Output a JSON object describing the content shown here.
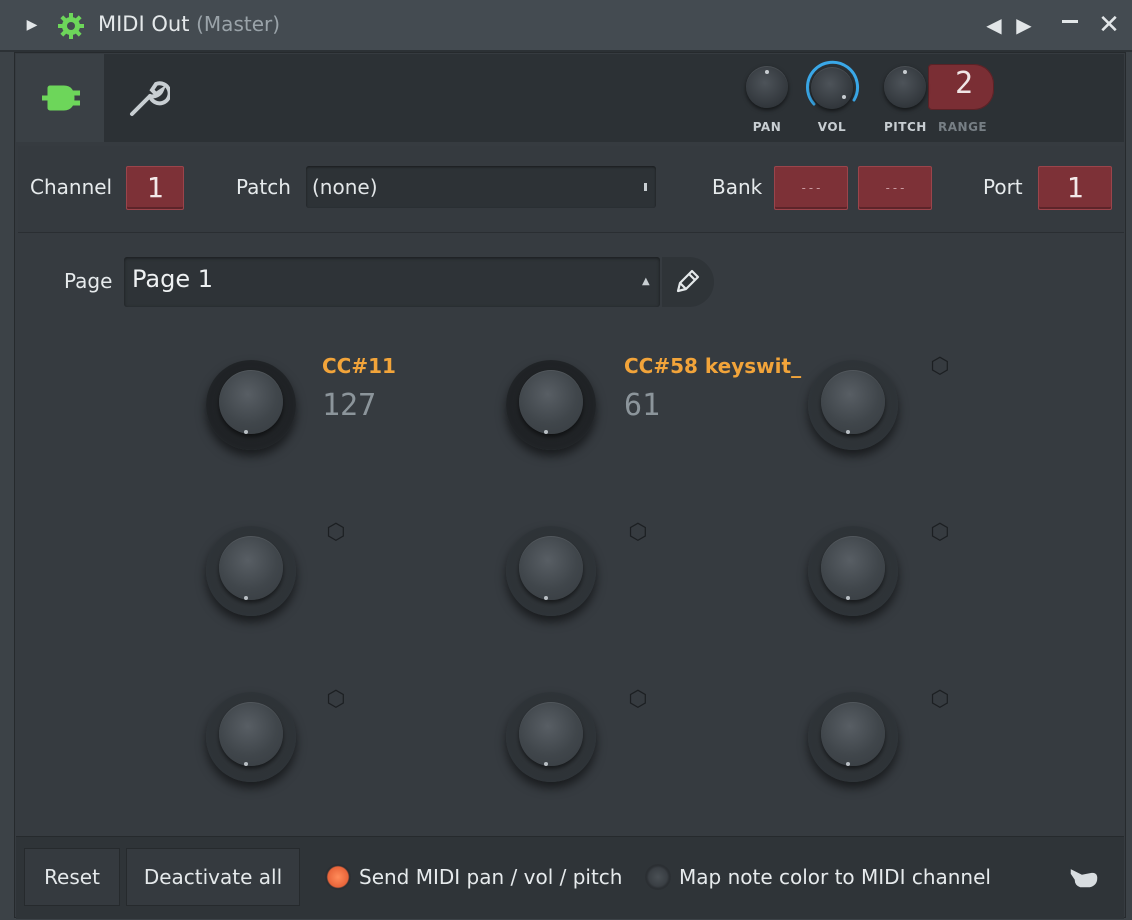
{
  "window": {
    "title": "MIDI Out",
    "subtitle": "(Master)"
  },
  "icons": {
    "expand": "triangle-right-icon",
    "plugin_gear": "gear-icon",
    "prev": "arrow-left-icon",
    "next": "arrow-right-icon",
    "minimize": "minimize-icon",
    "close": "close-icon",
    "plugin_tab": "plug-icon",
    "settings_tab": "wrench-icon",
    "page_edit": "pencil-icon",
    "hand": "hand-icon"
  },
  "colors": {
    "accent_orange": "#f2a43a",
    "plugin_green": "#6dd65a",
    "vol_blue": "#3aa8e8",
    "field_red": "#7d3137"
  },
  "top_knobs": {
    "pan_label": "PAN",
    "vol_label": "VOL",
    "pitch_label": "PITCH",
    "range_label": "RANGE",
    "range_value": "2"
  },
  "channel_row": {
    "channel_label": "Channel",
    "channel_value": "1",
    "patch_label": "Patch",
    "patch_value": "(none)",
    "bank_label": "Bank",
    "bank_value_1": "---",
    "bank_value_2": "---",
    "port_label": "Port",
    "port_value": "1"
  },
  "page_row": {
    "label": "Page",
    "value": "Page 1"
  },
  "knobs": [
    {
      "name": "CC#11",
      "value": "127",
      "assigned": true
    },
    {
      "name": "CC#58 keyswit_",
      "value": "61",
      "assigned": true
    },
    {
      "name": "",
      "value": "",
      "assigned": false
    },
    {
      "name": "",
      "value": "",
      "assigned": false
    },
    {
      "name": "",
      "value": "",
      "assigned": false
    },
    {
      "name": "",
      "value": "",
      "assigned": false
    },
    {
      "name": "",
      "value": "",
      "assigned": false
    },
    {
      "name": "",
      "value": "",
      "assigned": false
    },
    {
      "name": "",
      "value": "",
      "assigned": false
    }
  ],
  "bottom": {
    "reset_label": "Reset",
    "deactivate_label": "Deactivate all",
    "send_midi_label": "Send MIDI pan / vol / pitch",
    "send_midi_checked": true,
    "map_color_label": "Map note color to MIDI channel",
    "map_color_checked": false
  }
}
